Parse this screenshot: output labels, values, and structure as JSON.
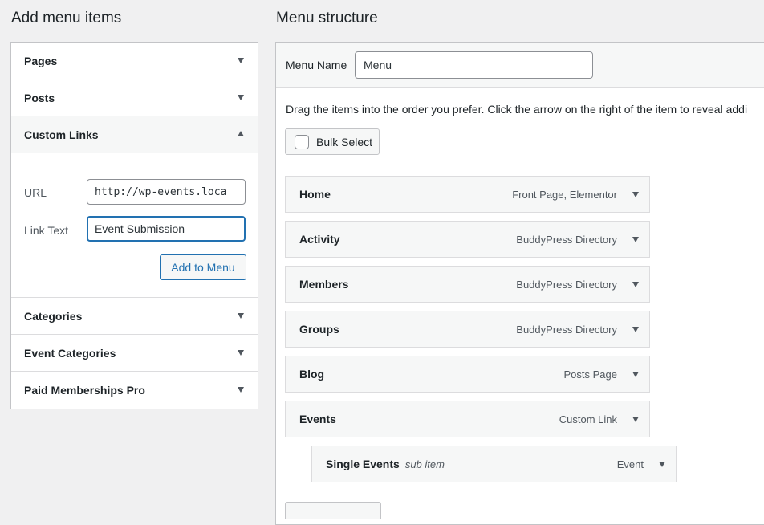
{
  "left": {
    "title": "Add menu items",
    "sections": [
      {
        "label": "Pages"
      },
      {
        "label": "Posts"
      },
      {
        "label": "Custom Links"
      },
      {
        "label": "Categories"
      },
      {
        "label": "Event Categories"
      },
      {
        "label": "Paid Memberships Pro"
      }
    ],
    "custom_links": {
      "url_label": "URL",
      "url_value": "http://wp-events.loca",
      "text_label": "Link Text",
      "text_value": "Event Submission",
      "add_button": "Add to Menu"
    }
  },
  "right": {
    "title": "Menu structure",
    "menu_name_label": "Menu Name",
    "menu_name_value": "Menu",
    "instructions": "Drag the items into the order you prefer. Click the arrow on the right of the item to reveal addi",
    "bulk_select": "Bulk Select",
    "items": [
      {
        "title": "Home",
        "type": "Front Page, Elementor"
      },
      {
        "title": "Activity",
        "type": "BuddyPress Directory"
      },
      {
        "title": "Members",
        "type": "BuddyPress Directory"
      },
      {
        "title": "Groups",
        "type": "BuddyPress Directory"
      },
      {
        "title": "Blog",
        "type": "Posts Page"
      },
      {
        "title": "Events",
        "type": "Custom Link"
      },
      {
        "title": "Single Events",
        "sub": "sub item",
        "type": "Event"
      }
    ]
  },
  "icons": {
    "collapse": "triangle-down-icon",
    "expand": "triangle-up-icon"
  },
  "colors": {
    "accent": "#2271b1",
    "panel_bg": "#f6f7f7",
    "page_bg": "#f0f0f1",
    "border": "#c3c4c7"
  }
}
